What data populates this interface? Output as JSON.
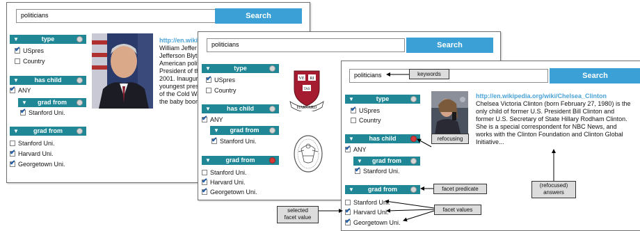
{
  "windows": [
    {
      "search": {
        "value": "politicians",
        "button": "Search"
      },
      "facets": {
        "type": {
          "title": "type",
          "options": [
            {
              "label": "USpres",
              "checked": true
            },
            {
              "label": "Country",
              "checked": false
            }
          ]
        },
        "has_child": {
          "title": "has child",
          "any_label": "ANY",
          "any_checked": true,
          "sub": {
            "title": "grad from",
            "options": [
              {
                "label": "Stanford Uni.",
                "checked": true
              }
            ]
          }
        },
        "grad_from": {
          "title": "grad from",
          "options": [
            {
              "label": "Stanford Uni.",
              "checked": false
            },
            {
              "label": "Harvard Uni.",
              "checked": true
            },
            {
              "label": "Georgetown Uni.",
              "checked": true
            }
          ]
        }
      },
      "result": {
        "url": "http://en.wiki",
        "lines": [
          "William Jeffer",
          "Jefferson Blyt",
          "American polit",
          "President of th",
          "2001. Inaugur",
          "youngest pres",
          "of the Cold Wa",
          "the baby boom"
        ]
      }
    },
    {
      "search": {
        "value": "politicians",
        "button": "Search"
      },
      "facets": {
        "type": {
          "title": "type",
          "options": [
            {
              "label": "USpres",
              "checked": true
            },
            {
              "label": "Country",
              "checked": false
            }
          ]
        },
        "has_child": {
          "title": "has child",
          "any_label": "ANY",
          "any_checked": true,
          "sub": {
            "title": "grad from",
            "options": [
              {
                "label": "Stanford Uni.",
                "checked": true
              }
            ]
          }
        },
        "grad_from": {
          "title": "grad from",
          "options": [
            {
              "label": "Stanford Uni.",
              "checked": false
            },
            {
              "label": "Harvard Uni.",
              "checked": true
            },
            {
              "label": "Georgetown Uni.",
              "checked": true
            }
          ]
        }
      },
      "seal": {
        "shield_text": [
          "VE",
          "RI",
          "TAS"
        ],
        "banner": "HARVARD"
      }
    },
    {
      "search": {
        "value": "politicians",
        "button": "Search"
      },
      "facets": {
        "type": {
          "title": "type",
          "options": [
            {
              "label": "USpres",
              "checked": true
            },
            {
              "label": "Country",
              "checked": false
            }
          ]
        },
        "has_child": {
          "title": "has child",
          "any_label": "ANY",
          "any_checked": true,
          "sub": {
            "title": "grad from",
            "options": [
              {
                "label": "Stanford Uni.",
                "checked": true
              }
            ]
          }
        },
        "grad_from": {
          "title": "grad from",
          "options": [
            {
              "label": "Stanford Uni.",
              "checked": false
            },
            {
              "label": "Harvard Uni.",
              "checked": true
            },
            {
              "label": "Georgetown Uni.",
              "checked": true
            }
          ]
        }
      },
      "result": {
        "url": "http://en.wikipedia.org/wiki/Chelsea_Clinton",
        "lines": [
          "Chelsea Victoria Clinton (born February 27, 1980) is the",
          "only child of former U.S. President Bill Clinton and",
          "former U.S. Secretary of State Hillary Rodham Clinton.",
          "She is a special correspondent for NBC News, and",
          "works with the Clinton Foundation and Clinton Global",
          "Initiative..."
        ]
      }
    }
  ],
  "annotations": {
    "keywords": "keywords",
    "refocusing": "refocusing",
    "facet_predicate": "facet predicate",
    "facet_values": "facet values",
    "selected_line1": "selected",
    "selected_line2": "facet value",
    "answers_line1": "(refocused)",
    "answers_line2": "answers"
  },
  "colors": {
    "search_button": "#3aa0d6",
    "facet_header": "#1f8795",
    "link": "#4ba3d6",
    "refocus_dot": "#d63b3b"
  }
}
